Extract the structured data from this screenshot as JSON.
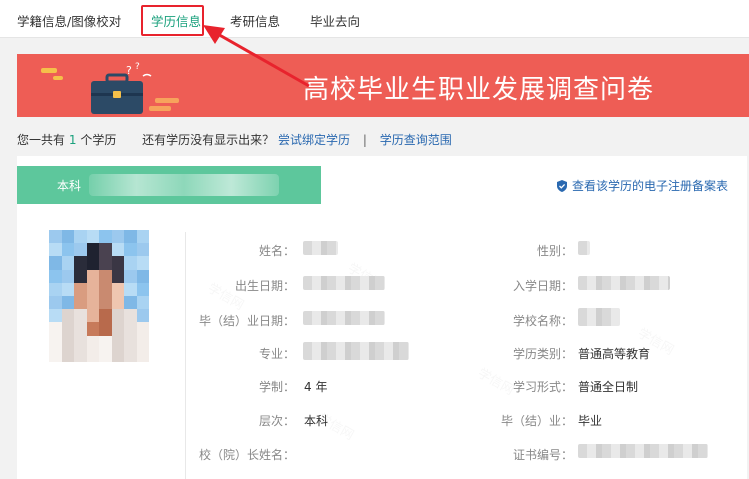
{
  "nav": {
    "items": [
      "学籍信息/图像校对",
      "学历信息",
      "考研信息",
      "毕业去向"
    ]
  },
  "banner": {
    "title": "高校毕业生职业发展调查问卷"
  },
  "info": {
    "prefix": "您一共有",
    "count": "1",
    "suffix": "个学历",
    "question": "还有学历没有显示出来？",
    "bind_link": "尝试绑定学历",
    "separator": "|",
    "scope_link": "学历查询范围"
  },
  "record": {
    "level_tab": "本科",
    "register_link": "查看该学历的电子注册备案表",
    "fields": {
      "name_label": "姓名：",
      "gender_label": "性别：",
      "birth_label": "出生日期：",
      "enroll_label": "入学日期：",
      "grad_date_label": "毕（结）业日期：",
      "school_label": "学校名称：",
      "major_label": "专业：",
      "category_label": "学历类别：",
      "category_value": "普通高等教育",
      "duration_label": "学制：",
      "duration_value": "4 年",
      "form_label": "学习形式：",
      "form_value": "普通全日制",
      "level_label": "层次：",
      "level_value": "本科",
      "grad_label": "毕（结）业：",
      "grad_value": "毕业",
      "president_label": "校（院）长姓名：",
      "cert_label": "证书编号："
    }
  },
  "colors": {
    "accent": "#1aa17d",
    "banner": "#ee5d55",
    "tab": "#5dc79c",
    "link": "#2a69b0",
    "highlight": "#e8232d"
  }
}
